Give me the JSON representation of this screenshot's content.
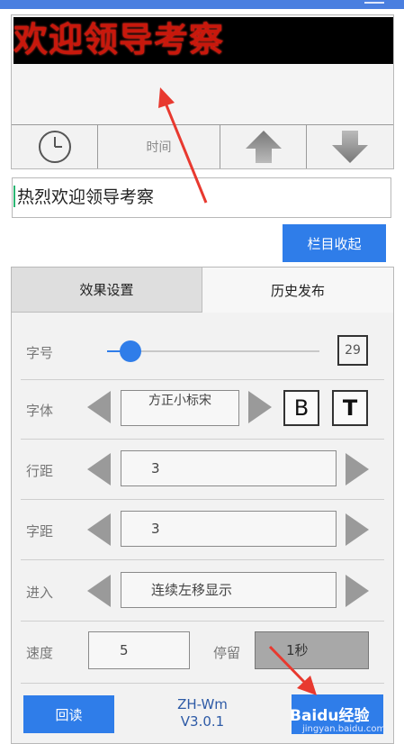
{
  "led_preview": {
    "text": "欢迎领导考察",
    "text_color": "#c8180c"
  },
  "controls": {
    "time_label": "时间"
  },
  "text_input": {
    "value": "热烈欢迎领导考察"
  },
  "collapse_button": {
    "label": "栏目收起"
  },
  "tabs": [
    {
      "label": "效果设置",
      "active": true
    },
    {
      "label": "历史发布",
      "active": false
    }
  ],
  "settings": {
    "font_size": {
      "label": "字号",
      "value": "29",
      "slider_fraction": 0.11
    },
    "font_family": {
      "label": "字体",
      "value": "方正小标宋",
      "bold_label": "B",
      "t_label": "T"
    },
    "line_spacing": {
      "label": "行距",
      "value": "3"
    },
    "char_spacing": {
      "label": "字距",
      "value": "3"
    },
    "enter_effect": {
      "label": "进入",
      "value": "连续左移显示"
    },
    "speed": {
      "label": "速度",
      "value": "5"
    },
    "stay": {
      "label": "停留",
      "value": "1秒"
    }
  },
  "footer": {
    "readback_label": "回读",
    "version_name": "ZH-Wm",
    "version_number": "V3.0.1",
    "watermark_main": "Baidu经验",
    "watermark_sub": "jingyan.baidu.com"
  },
  "colors": {
    "accent": "#2f7de9",
    "annotation_arrow": "#e8392f"
  }
}
